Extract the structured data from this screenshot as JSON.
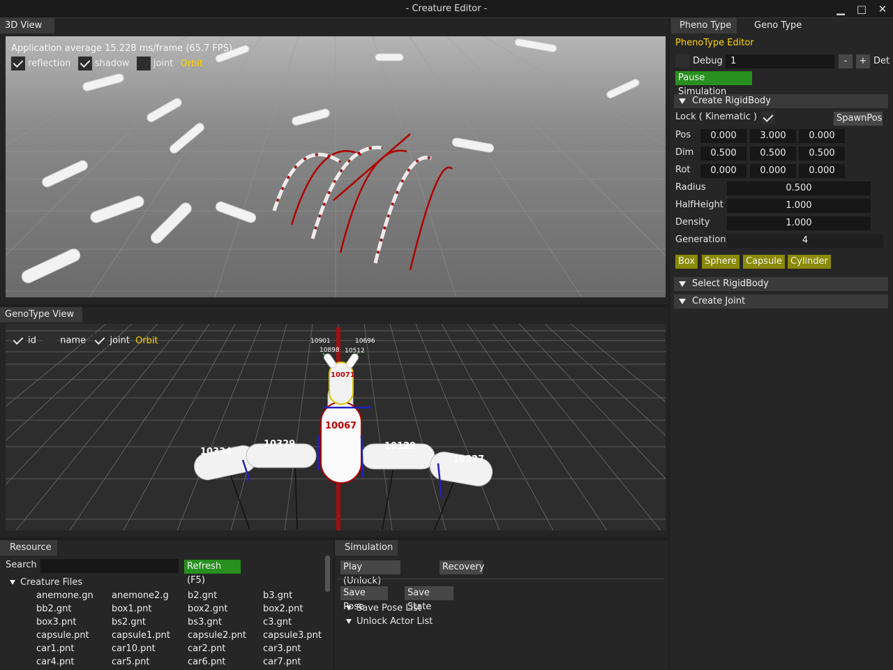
{
  "window": {
    "title": "- Creature Editor -",
    "minimize": "▁",
    "maximize": "□",
    "close": "✕"
  },
  "view3d": {
    "tab": "3D View",
    "fps": "Application average 15.228 ms/frame (65.7 FPS)",
    "reflection": "reflection",
    "shadow": "shadow",
    "joint": "joint",
    "orbit": "Orbit"
  },
  "genotype": {
    "tab": "GenoType View",
    "id": "id",
    "name": "name",
    "joint": "joint",
    "orbit": "Orbit",
    "labels": {
      "n10901": "10901",
      "n10696": "10696",
      "n10898": "10898",
      "n10512": "10512",
      "n10071": "10071",
      "n10067": "10067",
      "n10334": "10334",
      "n10329": "10329",
      "n10129": "10129",
      "n10227": "10227"
    }
  },
  "right": {
    "tab_pheno": "Pheno Type",
    "tab_geno": "Geno Type",
    "editor_title": "PhenoType Editor",
    "debug_label": "Debug",
    "debug_value": "1",
    "minus": "-",
    "plus": "+",
    "debug_suffix": "Det",
    "pause": "Pause Simulation",
    "create_rb": "Create RigidBody",
    "lock": "Lock ( Kinematic )",
    "spawnpos": "SpawnPos",
    "pos_label": "Pos",
    "pos": [
      "0.000",
      "3.000",
      "0.000"
    ],
    "dim_label": "Dim",
    "dim": [
      "0.500",
      "0.500",
      "0.500"
    ],
    "rot_label": "Rot",
    "rot": [
      "0.000",
      "0.000",
      "0.000"
    ],
    "radius_label": "Radius",
    "radius": "0.500",
    "halfheight_label": "HalfHeight",
    "halfheight": "1.000",
    "density_label": "Density",
    "density": "1.000",
    "generation_label": "Generation",
    "generation": "4",
    "shape_box": "Box",
    "shape_sphere": "Sphere",
    "shape_capsule": "Capsule",
    "shape_cylinder": "Cylinder",
    "select_rb": "Select RigidBody",
    "create_joint": "Create Joint"
  },
  "resource": {
    "tab": "Resource",
    "search_label": "Search",
    "search_value": "",
    "refresh": "Refresh (F5)",
    "creature_files": "Creature Files",
    "files": [
      [
        "anemone.gn",
        "anemone2.g",
        "b2.gnt",
        "b3.gnt"
      ],
      [
        "bb2.gnt",
        "box1.pnt",
        "box2.gnt",
        "box2.pnt"
      ],
      [
        "box3.pnt",
        "bs2.gnt",
        "bs3.gnt",
        "c3.gnt"
      ],
      [
        "capsule.pnt",
        "capsule1.pnt",
        "capsule2.pnt",
        "capsule3.pnt"
      ],
      [
        "car1.pnt",
        "car10.pnt",
        "car2.pnt",
        "car3.pnt"
      ],
      [
        "car4.pnt",
        "car5.pnt",
        "car6.pnt",
        "car7.pnt"
      ]
    ]
  },
  "simulation": {
    "tab": "Simulation",
    "play": "Play (Unlock)",
    "recovery": "Recovery",
    "save_pose": "Save Pose",
    "save_state": "Save State",
    "save_pose_list": "Save Pose List",
    "unlock_actor_list": "Unlock Actor List"
  }
}
